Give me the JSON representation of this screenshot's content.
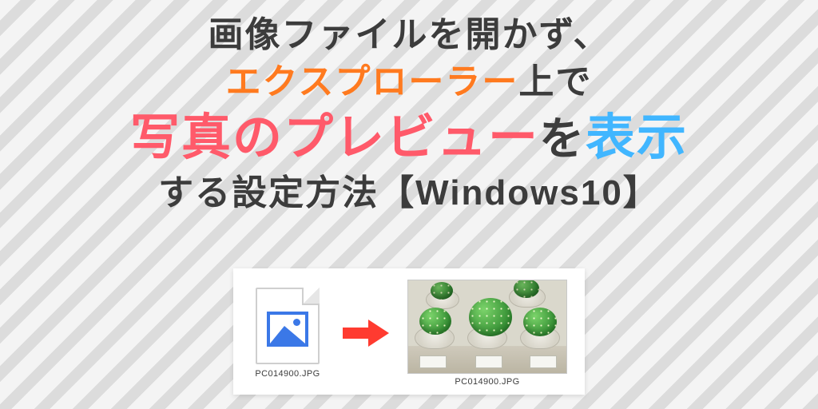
{
  "title": {
    "line1": "画像ファイルを開かず、",
    "line2_a": "エクスプローラー",
    "line2_b": "上で",
    "line3_a": "写真のプレビュー",
    "line3_b": "を",
    "line3_c": "表示",
    "line4": "する設定方法【Windows10】"
  },
  "demo": {
    "left_filename": "PC014900.JPG",
    "right_filename": "PC014900.JPG",
    "arrow_color": "#ff3b30",
    "icon_outline": "#3b78e7"
  }
}
